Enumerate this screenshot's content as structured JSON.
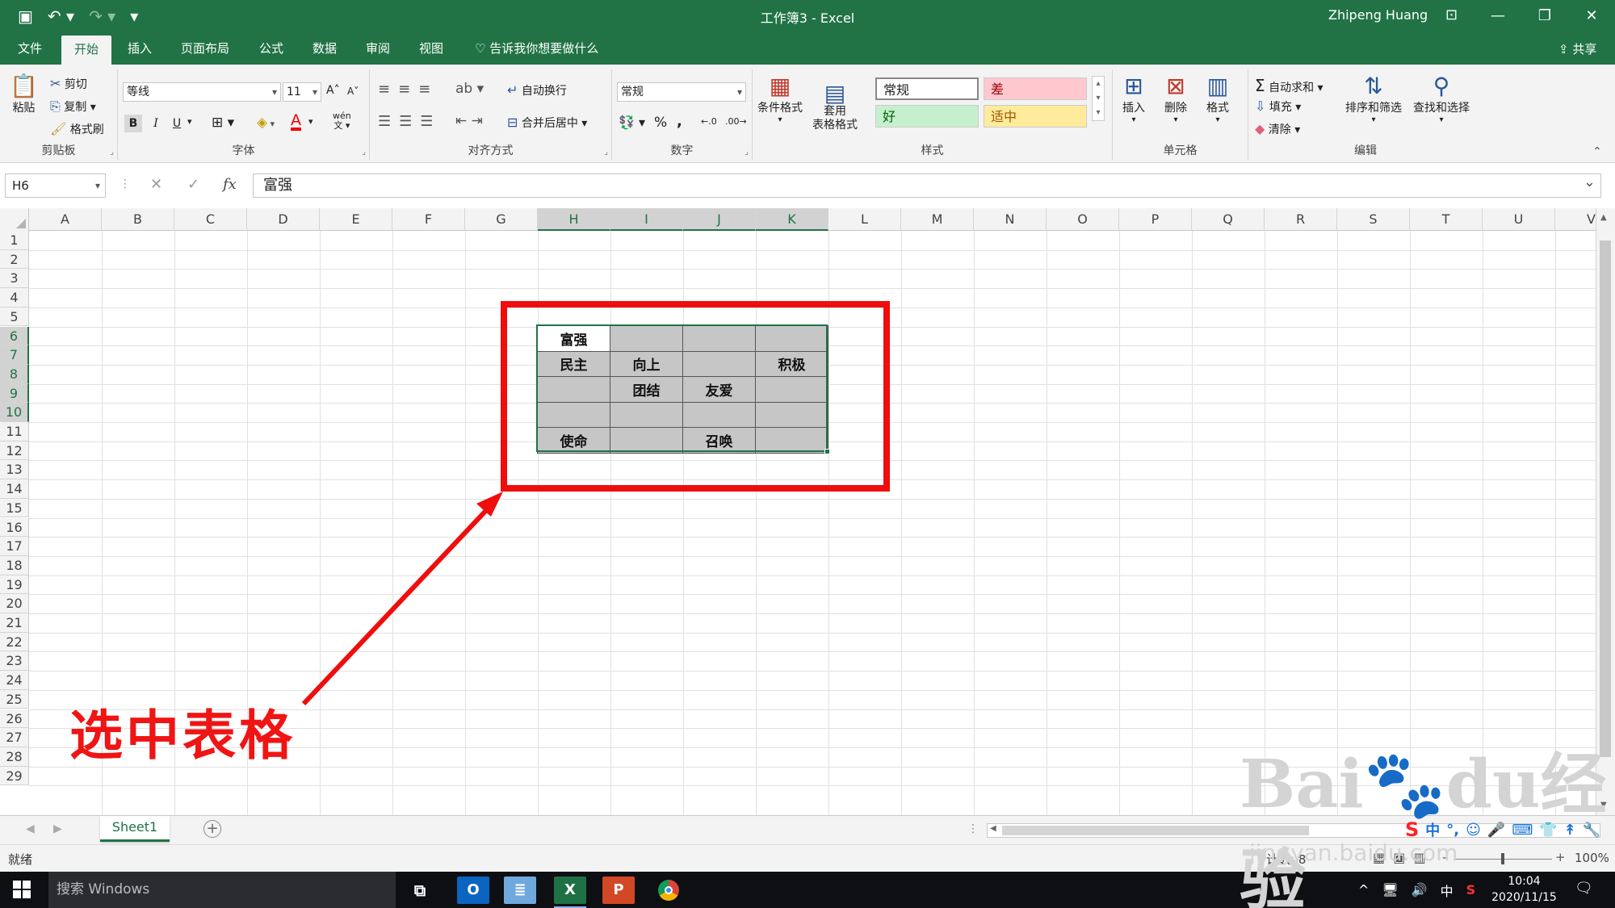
{
  "window": {
    "title": "工作簿3  -  Excel",
    "user": "Zhipeng Huang"
  },
  "qat": {
    "save": "💾",
    "undo": "↶ ▾",
    "redo": "↷ ▾",
    "more": "▾"
  },
  "tabs": [
    "文件",
    "开始",
    "插入",
    "页面布局",
    "公式",
    "数据",
    "审阅",
    "视图"
  ],
  "tell_me": "告诉我你想要做什么",
  "share": "共享",
  "ribbon": {
    "clipboard": {
      "paste": "粘贴",
      "cut": "剪切",
      "copy": "复制",
      "painter": "格式刷",
      "label": "剪贴板"
    },
    "font": {
      "name": "等线",
      "size": "11",
      "grow": "A˄",
      "shrink": "A˅",
      "bold": "B",
      "italic": "I",
      "underline": "U",
      "label": "字体",
      "wen": "wén"
    },
    "alignment": {
      "wrap": "自动换行",
      "merge": "合并后居中",
      "label": "对齐方式"
    },
    "number": {
      "format": "常规",
      "percent": "%",
      "comma": ",",
      "label": "数字"
    },
    "styles": {
      "conditional": "条件格式",
      "table": "套用\n表格格式",
      "normal": "常规",
      "bad": "差",
      "good": "好",
      "neutral": "适中",
      "label": "样式"
    },
    "cells": {
      "insert": "插入",
      "delete": "删除",
      "format": "格式",
      "label": "单元格"
    },
    "editing": {
      "autosum": "自动求和",
      "fill": "填充",
      "clear": "清除",
      "sort": "排序和筛选",
      "find": "查找和选择",
      "label": "编辑"
    },
    "colors": {
      "bad_bg": "#ffc7ce",
      "bad_fg": "#9c0006",
      "good_bg": "#c6efce",
      "good_fg": "#006100",
      "neutral_bg": "#ffeb9c",
      "neutral_fg": "#9c5700"
    }
  },
  "formula_bar": {
    "name_box": "H6",
    "cancel": "✕",
    "enter": "✓",
    "fx": "fx",
    "value": "富强"
  },
  "columns": [
    "A",
    "B",
    "C",
    "D",
    "E",
    "F",
    "G",
    "H",
    "I",
    "J",
    "K",
    "L",
    "M",
    "N",
    "O",
    "P",
    "Q",
    "R",
    "S",
    "T",
    "U",
    "V"
  ],
  "selected_columns": [
    "H",
    "I",
    "J",
    "K"
  ],
  "rows": [
    "1",
    "2",
    "3",
    "4",
    "5",
    "6",
    "7",
    "8",
    "9",
    "10",
    "11",
    "12",
    "13",
    "14",
    "15",
    "16",
    "17",
    "18",
    "19",
    "20",
    "21",
    "22",
    "23",
    "24",
    "25",
    "26",
    "27",
    "28",
    "29"
  ],
  "selected_rows": [
    "6",
    "7",
    "8",
    "9",
    "10"
  ],
  "table": [
    [
      "富强",
      "",
      "",
      ""
    ],
    [
      "民主",
      "向上",
      "",
      "积极"
    ],
    [
      "",
      "团结",
      "友爱",
      ""
    ],
    [
      "",
      "",
      "",
      ""
    ],
    [
      "使命",
      "",
      "召唤",
      ""
    ]
  ],
  "annotation": {
    "text": "选中表格",
    "color": "#f01414"
  },
  "watermark": {
    "brand": "Bai",
    "mark": "du",
    "cn": "经验",
    "url": "jingyan.baidu.com"
  },
  "sheet": {
    "tab": "Sheet1",
    "add": "+"
  },
  "ime": {
    "logo": "S",
    "items": [
      "中",
      "°,",
      "☺",
      "🎤",
      "⌨",
      "👕",
      "↟",
      "🔧"
    ]
  },
  "status": {
    "ready": "就绪",
    "count": "计数: 8",
    "zoom_minus": "-",
    "zoom_plus": "+",
    "zoom": "100%"
  },
  "taskbar": {
    "search": "搜索 Windows",
    "tray": [
      "^",
      "🖥",
      "🔊",
      "中",
      "S"
    ],
    "time": "10:04",
    "date": "2020/11/15",
    "notif": "🗨"
  }
}
